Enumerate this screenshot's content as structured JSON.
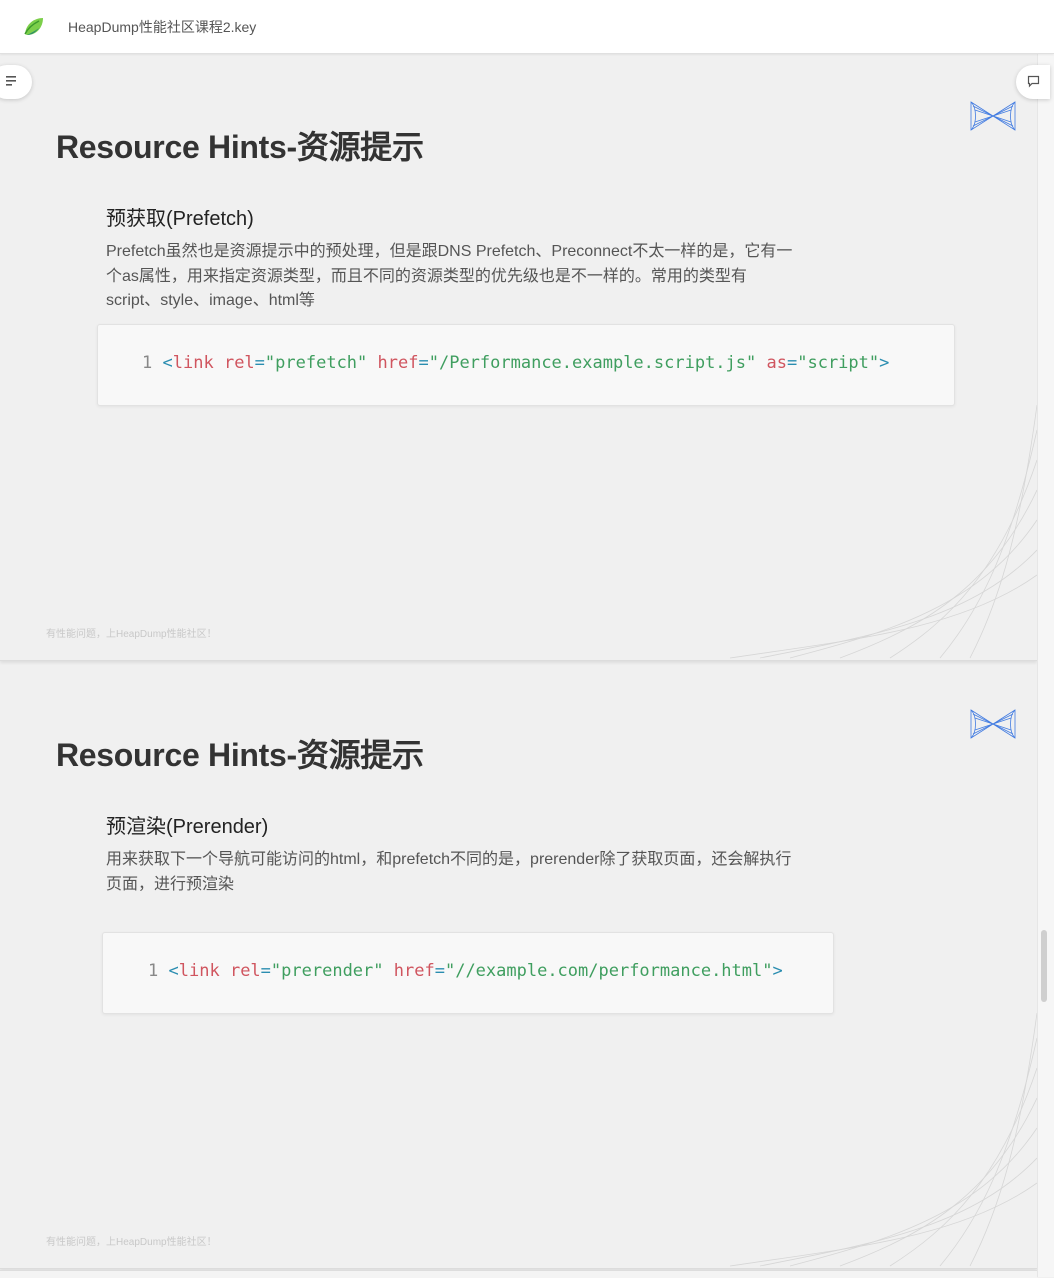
{
  "app": {
    "document_title": "HeapDump性能社区课程2.key",
    "logo_icon": "leaf-logo-icon",
    "toc_icon": "outline-list-icon",
    "comment_icon": "comment-icon"
  },
  "colors": {
    "page_bg": "#f0f0f0",
    "title": "#333333",
    "code_tag": "#d0555f",
    "code_string": "#3f9e5f",
    "code_punct": "#2a8db0",
    "logo_blue": "#2f6fe0"
  },
  "slides": [
    {
      "title": "Resource Hints-资源提示",
      "subtitle": "预获取(Prefetch)",
      "body_lines": [
        "Prefetch虽然也是资源提示中的预处理，但是跟DNS Prefetch、Preconnect不太一样的是，它有一",
        "个as属性，用来指定资源类型，而且不同的资源类型的优先级也是不一样的。常用的类型有",
        "script、style、image、html等"
      ],
      "code": {
        "line_number": "1",
        "open": "<",
        "tag": "link",
        "attr1": "rel",
        "eq1": "=",
        "val1": "\"prefetch\"",
        "attr2": "href",
        "eq2": "=",
        "val2": "\"/Performance.example.script.js\"",
        "attr3": "as",
        "eq3": "=",
        "val3": "\"script\"",
        "close": ">"
      },
      "footer": "有性能问题，上HeapDump性能社区！"
    },
    {
      "title": "Resource Hints-资源提示",
      "subtitle": "预渲染(Prerender)",
      "body_lines": [
        "用来获取下一个导航可能访问的html，和prefetch不同的是，prerender除了获取页面，还会解执行",
        "页面，进行预渲染"
      ],
      "code": {
        "line_number": "1",
        "open": "<",
        "tag": "link",
        "attr1": "rel",
        "eq1": "=",
        "val1": "\"prerender\"",
        "attr2": "href",
        "eq2": "=",
        "val2": "\"//example.com/performance.html\"",
        "close": ">"
      },
      "footer": "有性能问题，上HeapDump性能社区！"
    }
  ]
}
